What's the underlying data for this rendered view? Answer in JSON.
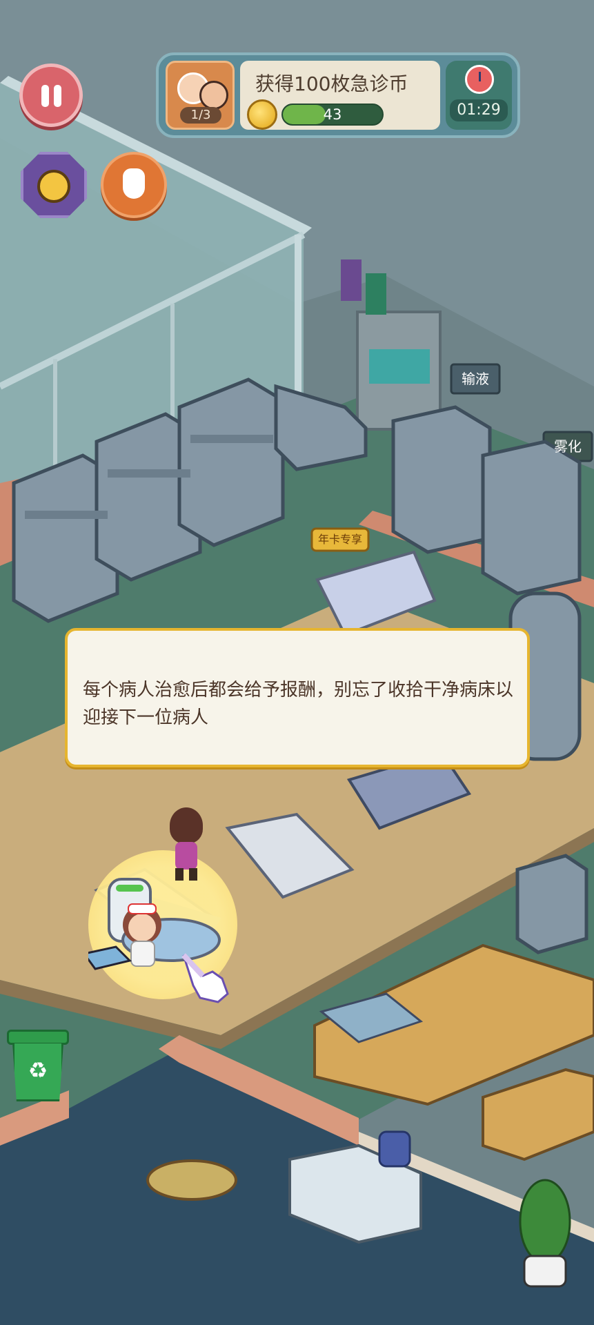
{
  "hud": {
    "pause_label": "",
    "task": {
      "progress": "1/3",
      "title": "获得100枚急诊币",
      "coin_count": "43",
      "coin_fraction": 0.43,
      "timer": "01:29"
    }
  },
  "room_signs": {
    "infusion": "输液",
    "nebulization": "雾化",
    "bed_badge": "年卡专享"
  },
  "dialog": {
    "text": "每个病人治愈后都会给予报酬，别忘了收拾干净病床以迎接下一位病人"
  },
  "colors": {
    "accent_gold": "#e6b52f",
    "pause_red": "#d9646b",
    "coin_green": "#6fb54a"
  }
}
